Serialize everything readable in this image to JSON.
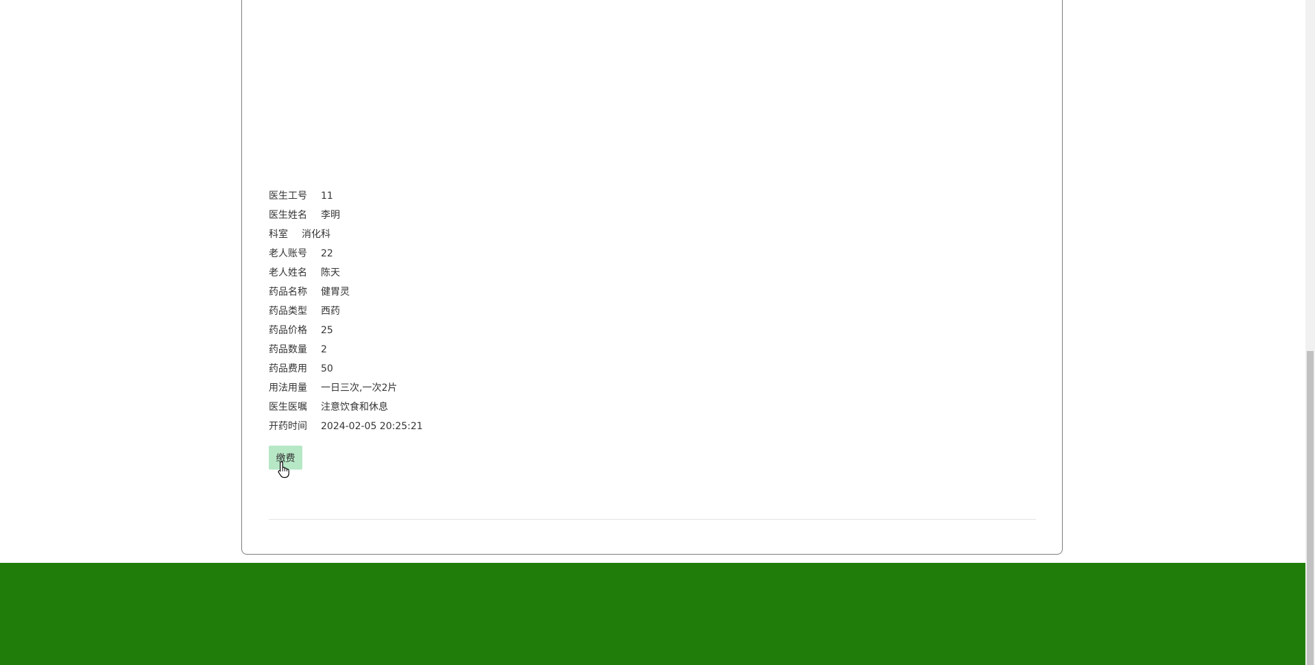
{
  "details": [
    {
      "label": "医生工号",
      "value": "11"
    },
    {
      "label": "医生姓名",
      "value": "李明"
    },
    {
      "label": "科室",
      "value": "消化科"
    },
    {
      "label": "老人账号",
      "value": "22"
    },
    {
      "label": "老人姓名",
      "value": "陈天"
    },
    {
      "label": "药品名称",
      "value": "健胃灵"
    },
    {
      "label": "药品类型",
      "value": "西药"
    },
    {
      "label": "药品价格",
      "value": "25"
    },
    {
      "label": "药品数量",
      "value": "2"
    },
    {
      "label": "药品费用",
      "value": "50"
    },
    {
      "label": "用法用量",
      "value": "一日三次,一次2片"
    },
    {
      "label": "医生医嘱",
      "value": "注意饮食和休息"
    },
    {
      "label": "开药时间",
      "value": "2024-02-05 20:25:21"
    }
  ],
  "pay_button_label": "缴费",
  "colors": {
    "footer": "#217d09",
    "pay_button": "#b7e8c6"
  }
}
